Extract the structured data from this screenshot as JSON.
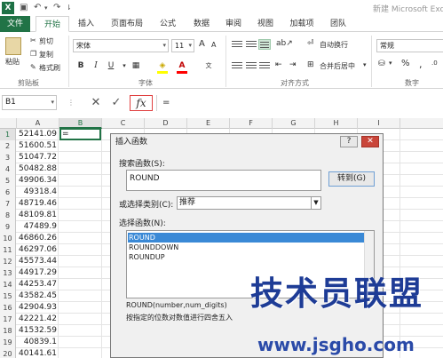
{
  "titlebar": {
    "doc_title": "新建 Microsoft Exc",
    "app_icon": "X"
  },
  "tabs": [
    "文件",
    "开始",
    "插入",
    "页面布局",
    "公式",
    "数据",
    "审阅",
    "视图",
    "加载项",
    "团队"
  ],
  "ribbon": {
    "paste": "粘贴",
    "cut": "剪切",
    "copy": "复制",
    "format_painter": "格式刷",
    "clipboard_group": "剪贴板",
    "font_name": "宋体",
    "font_size": "11",
    "grow_font": "A",
    "shrink_font": "A",
    "bold": "B",
    "italic": "I",
    "underline": "U",
    "font_group": "字体",
    "wrap_text": "自动换行",
    "merge_center": "合并后居中",
    "alignment_group": "对齐方式",
    "number_format": "常规",
    "percent": "%",
    "comma": ",",
    "number_group": "数字"
  },
  "formula_bar": {
    "name_box": "B1",
    "cancel": "✕",
    "enter": "✓",
    "fx": "fx",
    "formula": "="
  },
  "columns": [
    "A",
    "B",
    "C",
    "D",
    "E",
    "F",
    "G",
    "H",
    "I"
  ],
  "rows": [
    {
      "n": "1",
      "a": "52141.09",
      "b": "="
    },
    {
      "n": "2",
      "a": "51600.51"
    },
    {
      "n": "3",
      "a": "51047.72"
    },
    {
      "n": "4",
      "a": "50482.88"
    },
    {
      "n": "5",
      "a": "49906.34"
    },
    {
      "n": "6",
      "a": "49318.4"
    },
    {
      "n": "7",
      "a": "48719.46"
    },
    {
      "n": "8",
      "a": "48109.81"
    },
    {
      "n": "9",
      "a": "47489.9"
    },
    {
      "n": "10",
      "a": "46860.26"
    },
    {
      "n": "11",
      "a": "46297.06"
    },
    {
      "n": "12",
      "a": "45573.44"
    },
    {
      "n": "13",
      "a": "44917.29"
    },
    {
      "n": "14",
      "a": "44253.47"
    },
    {
      "n": "15",
      "a": "43582.45"
    },
    {
      "n": "16",
      "a": "42904.93"
    },
    {
      "n": "17",
      "a": "42221.42"
    },
    {
      "n": "18",
      "a": "41532.59"
    },
    {
      "n": "19",
      "a": "40839.1"
    },
    {
      "n": "20",
      "a": "40141.61"
    }
  ],
  "dialog": {
    "title": "插入函数",
    "help": "?",
    "close": "✕",
    "search_label": "搜索函数(S):",
    "search_value": "ROUND",
    "go_button": "转到(G)",
    "category_label": "或选择类别(C):",
    "category_value": "推荐",
    "list_label": "选择函数(N):",
    "functions": [
      "ROUND",
      "ROUNDDOWN",
      "ROUNDUP"
    ],
    "signature": "ROUND(number,num_digits)",
    "description": "按指定的位数对数值进行四舍五入"
  },
  "watermark": {
    "title": "技术员联盟",
    "url": "www.jsgho.com"
  }
}
